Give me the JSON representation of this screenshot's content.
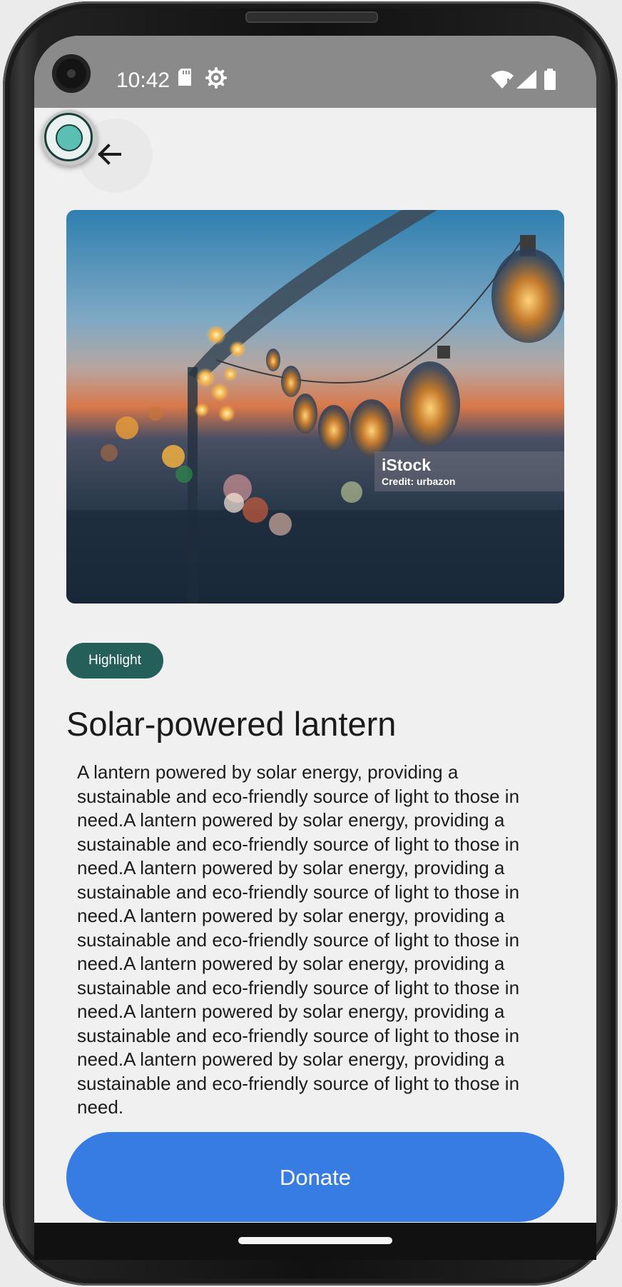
{
  "status_bar": {
    "time": "10:42",
    "icons": [
      "sd-card-icon",
      "gear-icon",
      "wifi-icon",
      "signal-icon",
      "battery-icon"
    ]
  },
  "navigation": {
    "back_icon": "back-arrow-icon"
  },
  "hero_image": {
    "description_icon": "string-lights-photo",
    "credit_brand": "iStock",
    "credit_text": "Credit: urbazon"
  },
  "chip": {
    "label": "Highlight"
  },
  "item": {
    "title": "Solar-powered lantern",
    "description": "A lantern powered by solar energy, providing a sustainable and eco-friendly source of light to those in need.A lantern powered by solar energy, providing a sustainable and eco-friendly source of light to those in need.A lantern powered by solar energy, providing a sustainable and eco-friendly source of light to those in need.A lantern powered by solar energy, providing a sustainable and eco-friendly source of light to those in need.A lantern powered by solar energy, providing a sustainable and eco-friendly source of light to those in need.A lantern powered by solar energy, providing a sustainable and eco-friendly source of light to those in need.A lantern powered by solar energy, providing a sustainable and eco-friendly source of light to those in need."
  },
  "actions": {
    "donate_label": "Donate"
  },
  "colors": {
    "chip": "#255f5a",
    "donate_button": "#367ce3",
    "background": "#f0f0f0",
    "status_bar": "#8a8a8a"
  }
}
